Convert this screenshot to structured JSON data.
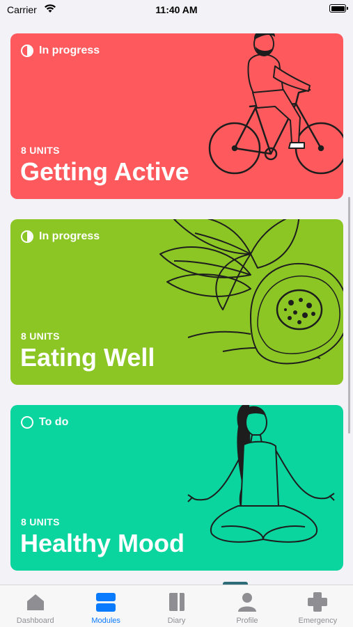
{
  "status_bar": {
    "carrier": "Carrier",
    "time": "11:40 AM"
  },
  "cards": [
    {
      "status": "In progress",
      "units": "8 UNITS",
      "title": "Getting Active",
      "color": "#fe5a5e",
      "illustration": "cyclist"
    },
    {
      "status": "In progress",
      "units": "8 UNITS",
      "title": "Eating Well",
      "color": "#8bc625",
      "illustration": "avocado"
    },
    {
      "status": "To do",
      "units": "8 UNITS",
      "title": "Healthy Mood",
      "color": "#0ad59f",
      "illustration": "meditating-woman"
    }
  ],
  "tab_bar": {
    "items": [
      {
        "label": "Dashboard",
        "icon": "home-icon"
      },
      {
        "label": "Modules",
        "icon": "modules-icon",
        "active": true
      },
      {
        "label": "Diary",
        "icon": "book-icon"
      },
      {
        "label": "Profile",
        "icon": "profile-icon"
      },
      {
        "label": "Emergency",
        "icon": "medical-cross-icon"
      }
    ]
  },
  "colors": {
    "accent": "#0a7aff",
    "inactive": "#8e8e93"
  }
}
